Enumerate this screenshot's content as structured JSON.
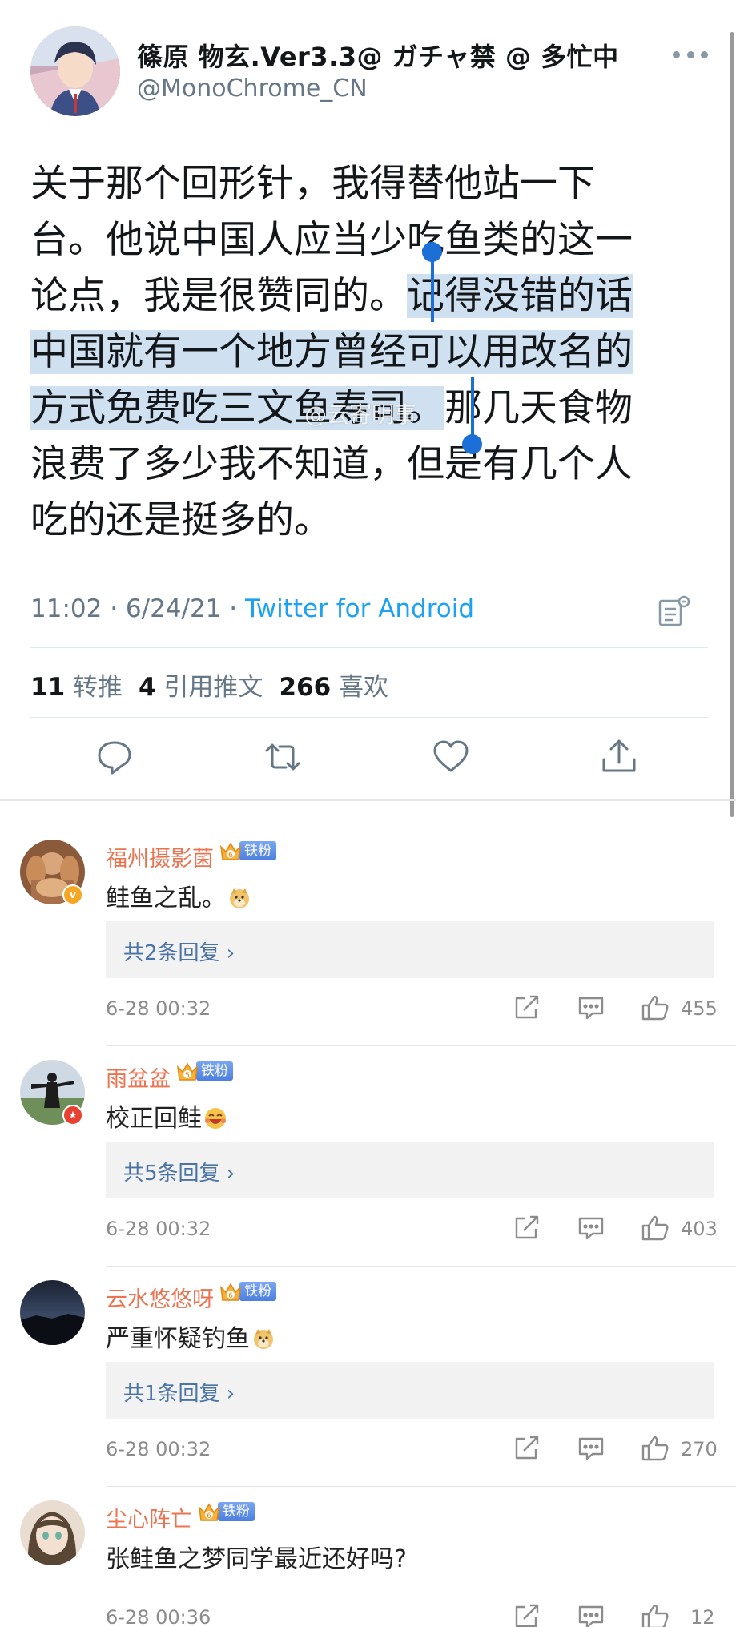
{
  "tweet": {
    "author_name": "篠原 物玄.Ver3.3@ ガチャ禁 @ 多忙中",
    "handle": "@MonoChrome_CN",
    "text_lines": [
      {
        "before": "关于那个回形针，我得替他站一下",
        "highlight": "",
        "after": ""
      },
      {
        "before": "台。他说中国人应当少吃鱼类的这一",
        "highlight": "",
        "after": ""
      },
      {
        "before": "论点，我是很赞同的。",
        "highlight": "记得没错的话",
        "after": ""
      },
      {
        "before": "",
        "highlight": "中国就有一个地方曾经可以用改名的",
        "after": ""
      },
      {
        "before": "",
        "highlight": "方式免费吃三文鱼寿司。",
        "after": "那几天食物"
      },
      {
        "before": "浪费了多少我不知道，但是有几个人",
        "highlight": "",
        "after": ""
      },
      {
        "before": "吃的还是挺多的。",
        "highlight": "",
        "after": ""
      }
    ],
    "watermark": "@云寄明事",
    "time": "11:02 · 6/24/21 · ",
    "source": "Twitter for Android",
    "retweets": "11",
    "retweets_label": "转推",
    "quotes": "4",
    "quotes_label": "引用推文",
    "likes": "266",
    "likes_label": "喜欢",
    "icons": {
      "reply": "reply-icon",
      "retweet": "retweet-icon",
      "like": "heart-icon",
      "share": "share-icon",
      "analytics": "analytics-icon",
      "more": "more-icon"
    }
  },
  "comments": [
    {
      "name": "福州摄影菌",
      "fan_label": "铁粉",
      "fan_level": "6",
      "text": "鲑鱼之乱。",
      "emoji": "doge",
      "reply_label": "共2条回复 ›",
      "time": "6-28 00:32",
      "likes": "455",
      "verified": "v"
    },
    {
      "name": "雨盆盆",
      "fan_label": "铁粉",
      "fan_level": "5",
      "text": "校正回鲑",
      "emoji": "haha",
      "reply_label": "共5条回复 ›",
      "time": "6-28 00:32",
      "likes": "403",
      "verified": "★"
    },
    {
      "name": "云水悠悠呀",
      "fan_label": "铁粉",
      "fan_level": "6",
      "text": "严重怀疑钓鱼",
      "emoji": "doge",
      "reply_label": "共1条回复 ›",
      "time": "6-28 00:32",
      "likes": "270",
      "verified": ""
    },
    {
      "name": "尘心阵亡",
      "fan_label": "铁粉",
      "fan_level": "6",
      "text": "张鲑鱼之梦同学最近还好吗?",
      "emoji": "",
      "reply_label": "",
      "time": "6-28 00:36",
      "likes": "12",
      "verified": ""
    }
  ],
  "colors": {
    "accent": "#1da1f2",
    "weibo_name": "#eb7350",
    "highlight": "#cfe0f1",
    "selection": "#1d6fd8"
  }
}
